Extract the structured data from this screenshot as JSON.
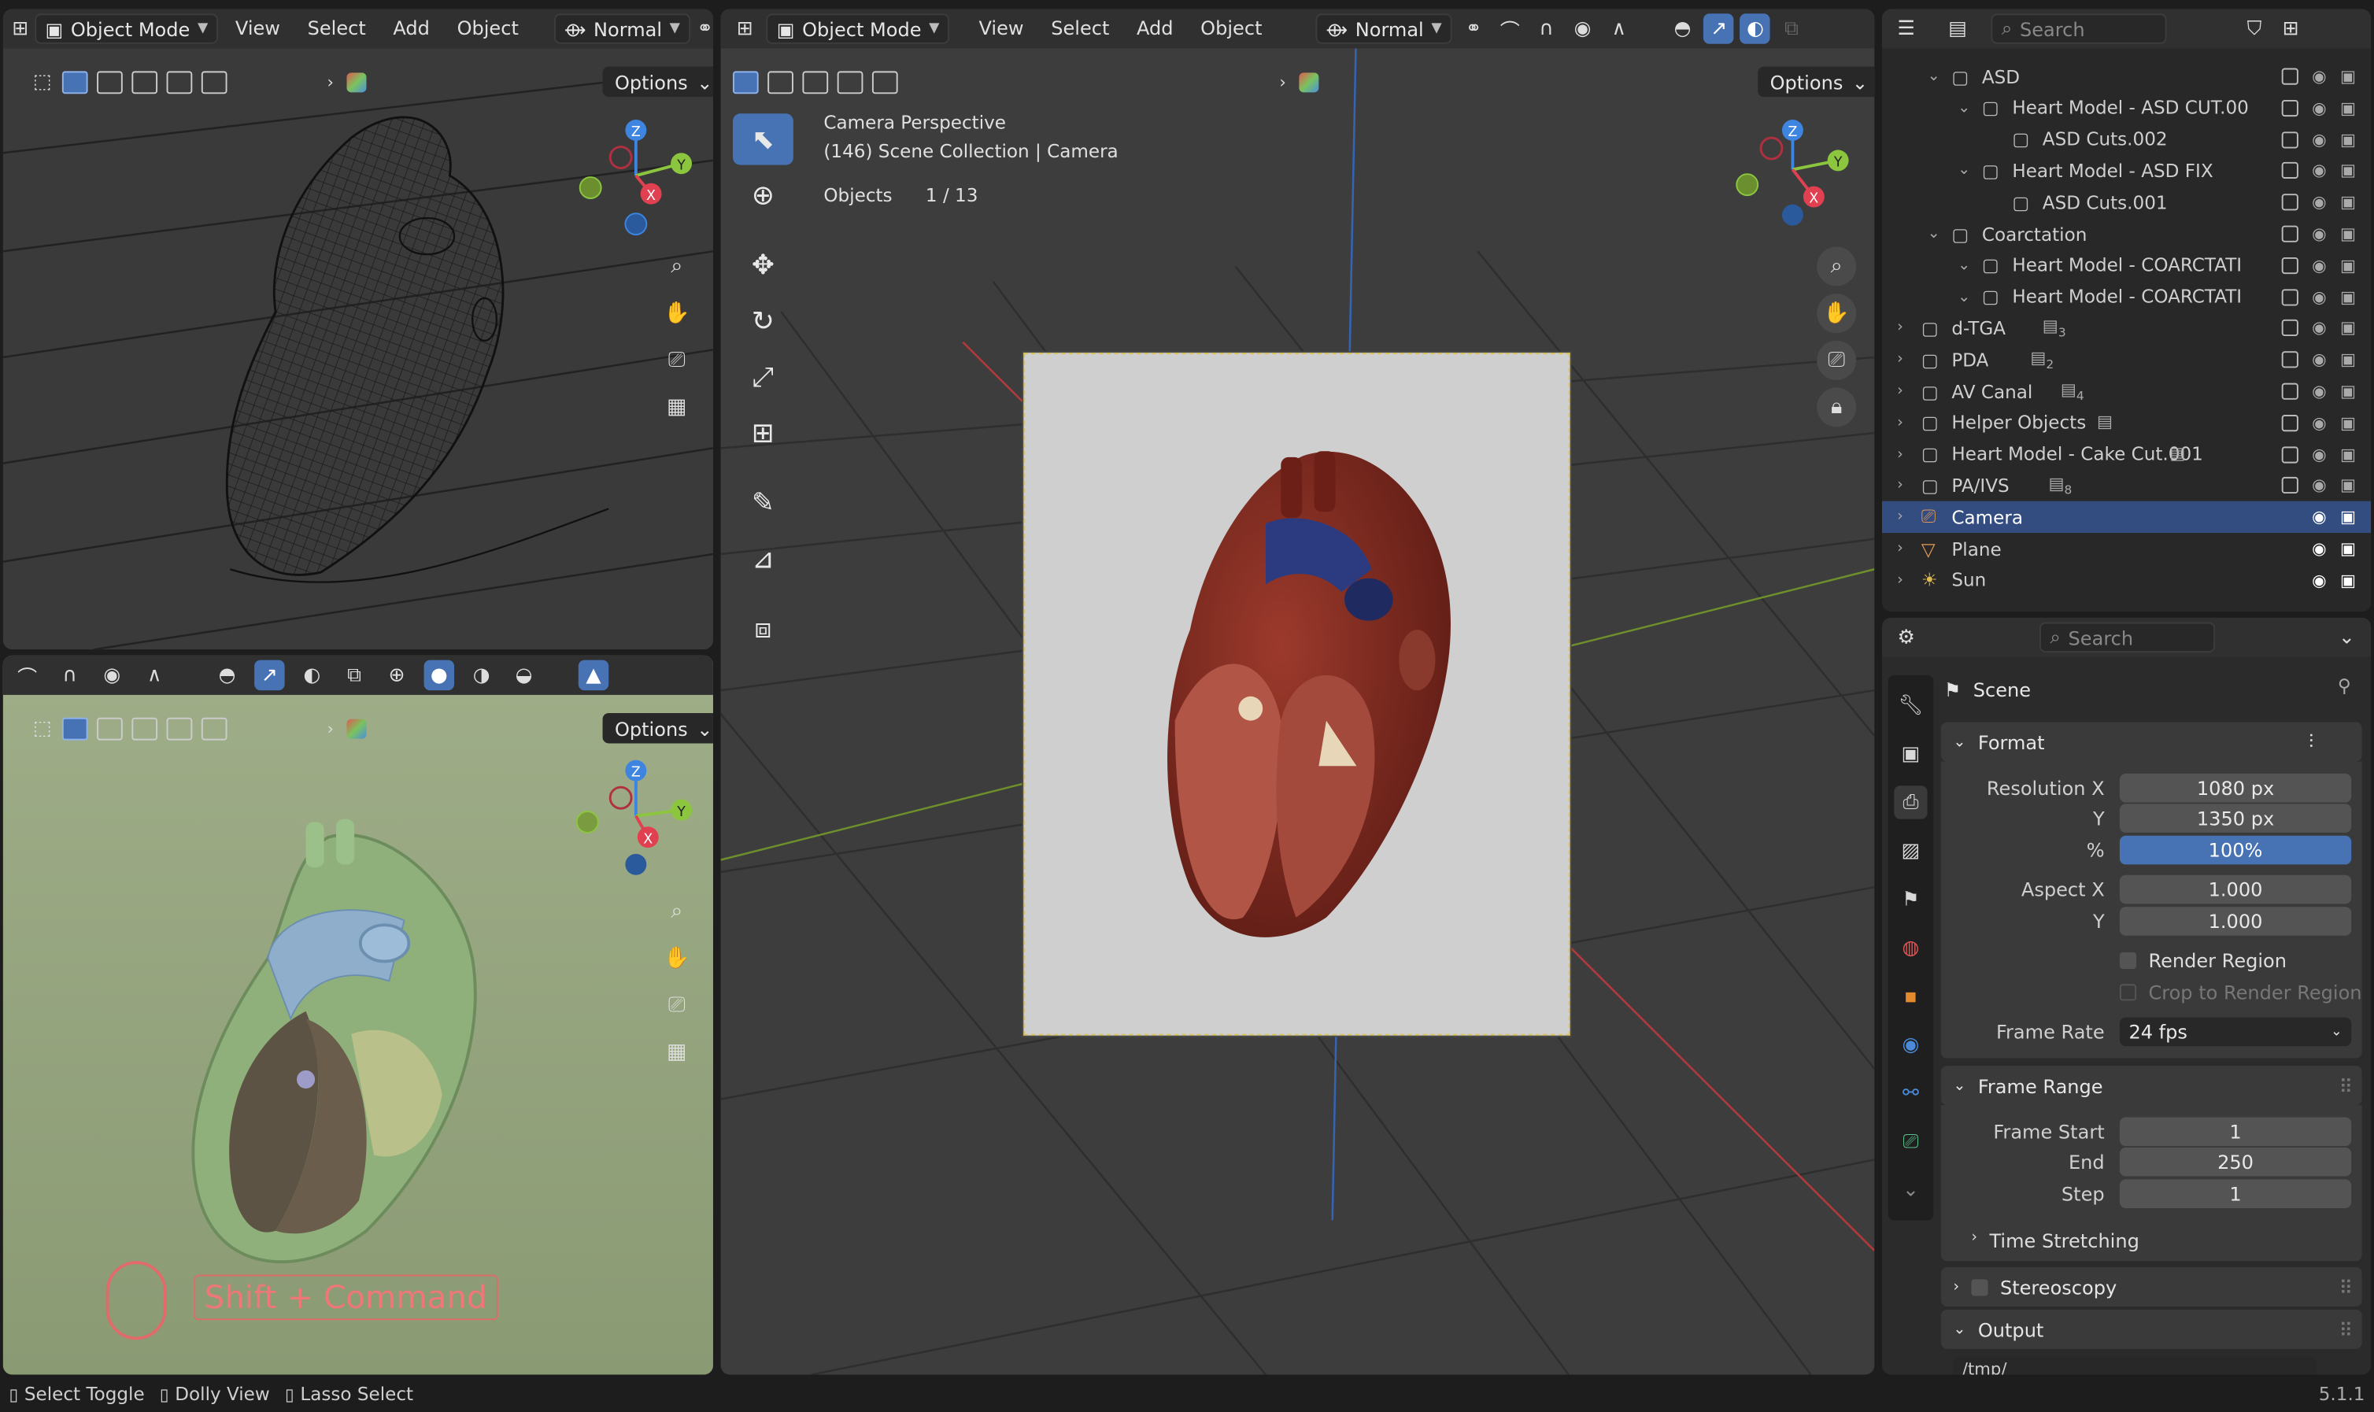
{
  "top_left_viewport": {
    "mode": "Object Mode",
    "menus": [
      "View",
      "Select",
      "Add",
      "Object"
    ],
    "orientation": "Normal",
    "options": "Options"
  },
  "bottom_left_viewport": {
    "options": "Options",
    "overlay_text": "Shift + Command"
  },
  "main_viewport": {
    "mode": "Object Mode",
    "menus": [
      "View",
      "Select",
      "Add",
      "Object"
    ],
    "orientation": "Normal",
    "options": "Options",
    "info_line1": "Camera Perspective",
    "info_line2": "(146) Scene Collection | Camera",
    "objects_label": "Objects",
    "objects_count": "1 / 13",
    "gizmo_axes": [
      "Z",
      "Y",
      "X"
    ]
  },
  "outliner": {
    "search_placeholder": "Search",
    "rows": [
      {
        "label": "ASD",
        "type": "collection",
        "indent": 2
      },
      {
        "label": "Heart Model - ASD CUT.00",
        "type": "collection",
        "indent": 3
      },
      {
        "label": "ASD Cuts.002",
        "type": "collection",
        "indent": 4
      },
      {
        "label": "Heart Model - ASD FIX",
        "type": "collection",
        "indent": 3
      },
      {
        "label": "ASD Cuts.001",
        "type": "collection",
        "indent": 4
      },
      {
        "label": "Coarctation",
        "type": "collection",
        "indent": 2
      },
      {
        "label": "Heart Model - COARCTATI",
        "type": "collection",
        "indent": 3
      },
      {
        "label": "Heart Model - COARCTATI",
        "type": "collection",
        "indent": 3
      },
      {
        "label": "d-TGA",
        "type": "collection",
        "indent": 1,
        "badge": "3"
      },
      {
        "label": "PDA",
        "type": "collection",
        "indent": 1,
        "badge": "2"
      },
      {
        "label": "AV Canal",
        "type": "collection",
        "indent": 1,
        "badge": "4"
      },
      {
        "label": "Helper Objects",
        "type": "collection",
        "indent": 1,
        "badge": ""
      },
      {
        "label": "Heart Model - Cake Cut.001",
        "type": "collection",
        "indent": 1,
        "badge": ""
      },
      {
        "label": "PA/IVS",
        "type": "collection",
        "indent": 1,
        "badge": "8"
      },
      {
        "label": "Camera",
        "type": "camera",
        "indent": 1,
        "selected": true
      },
      {
        "label": "Plane",
        "type": "mesh",
        "indent": 1
      },
      {
        "label": "Sun",
        "type": "light",
        "indent": 1
      }
    ]
  },
  "properties": {
    "search_placeholder": "Search",
    "context": "Scene",
    "format_panel": "Format",
    "resolution_x_label": "Resolution X",
    "resolution_x": "1080 px",
    "resolution_y_label": "Y",
    "resolution_y": "1350 px",
    "percent_label": "%",
    "percent": "100%",
    "aspect_x_label": "Aspect X",
    "aspect_x": "1.000",
    "aspect_y_label": "Y",
    "aspect_y": "1.000",
    "render_region": "Render Region",
    "crop_region": "Crop to Render Region",
    "frame_rate_label": "Frame Rate",
    "frame_rate": "24 fps",
    "frame_range_panel": "Frame Range",
    "frame_start_label": "Frame Start",
    "frame_start": "1",
    "frame_end_label": "End",
    "frame_end": "250",
    "frame_step_label": "Step",
    "frame_step": "1",
    "time_stretching": "Time Stretching",
    "stereoscopy": "Stereoscopy",
    "output_panel": "Output",
    "output_path": "/tmp/"
  },
  "status_bar": {
    "item1": "Select Toggle",
    "item2": "Dolly View",
    "item3": "Lasso Select",
    "version": "5.1.1"
  },
  "colors": {
    "accent": "#4772b3",
    "selection_row": "#334d80",
    "axis_x": "#e0404f",
    "axis_y": "#8cc63f",
    "axis_z": "#3d85e0"
  }
}
